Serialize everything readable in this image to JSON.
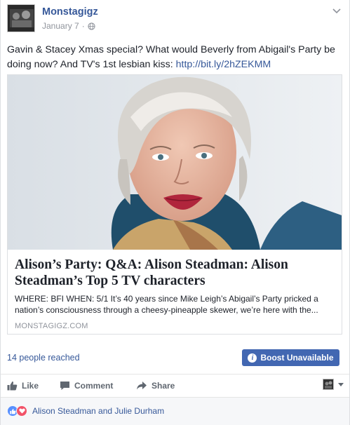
{
  "post": {
    "page_name": "Monstagigz",
    "date": "January 7",
    "separator": "·",
    "message": "Gavin & Stacey Xmas special? What would Beverly from Abigail's Party be doing now? And TV's 1st lesbian kiss: ",
    "link_text": "http://bit.ly/2hZEKMM"
  },
  "card": {
    "title": "Alison’s Party: Q&A: Alison Steadman: Alison Steadman’s Top 5 TV characters",
    "description": "WHERE: BFI WHEN: 5/1 It’s 40 years since Mike Leigh’s Abigail’s Party pricked a nation’s consciousness through a cheesy-pineapple skewer, we’re here with the...",
    "source": "MONSTAGIGZ.COM"
  },
  "stats": {
    "reached": "14 people reached",
    "boost_label": "Boost Unavailable"
  },
  "actions": {
    "like": "Like",
    "comment": "Comment",
    "share": "Share"
  },
  "reactions": {
    "names": "Alison Steadman and Julie Durham"
  },
  "colors": {
    "link": "#365899",
    "boost": "#4267b2",
    "like": "#5890ff",
    "love": "#f25268"
  },
  "icons": [
    "globe-icon",
    "chevron-down-icon",
    "info-icon",
    "like-icon",
    "comment-icon",
    "share-icon",
    "love-icon"
  ]
}
